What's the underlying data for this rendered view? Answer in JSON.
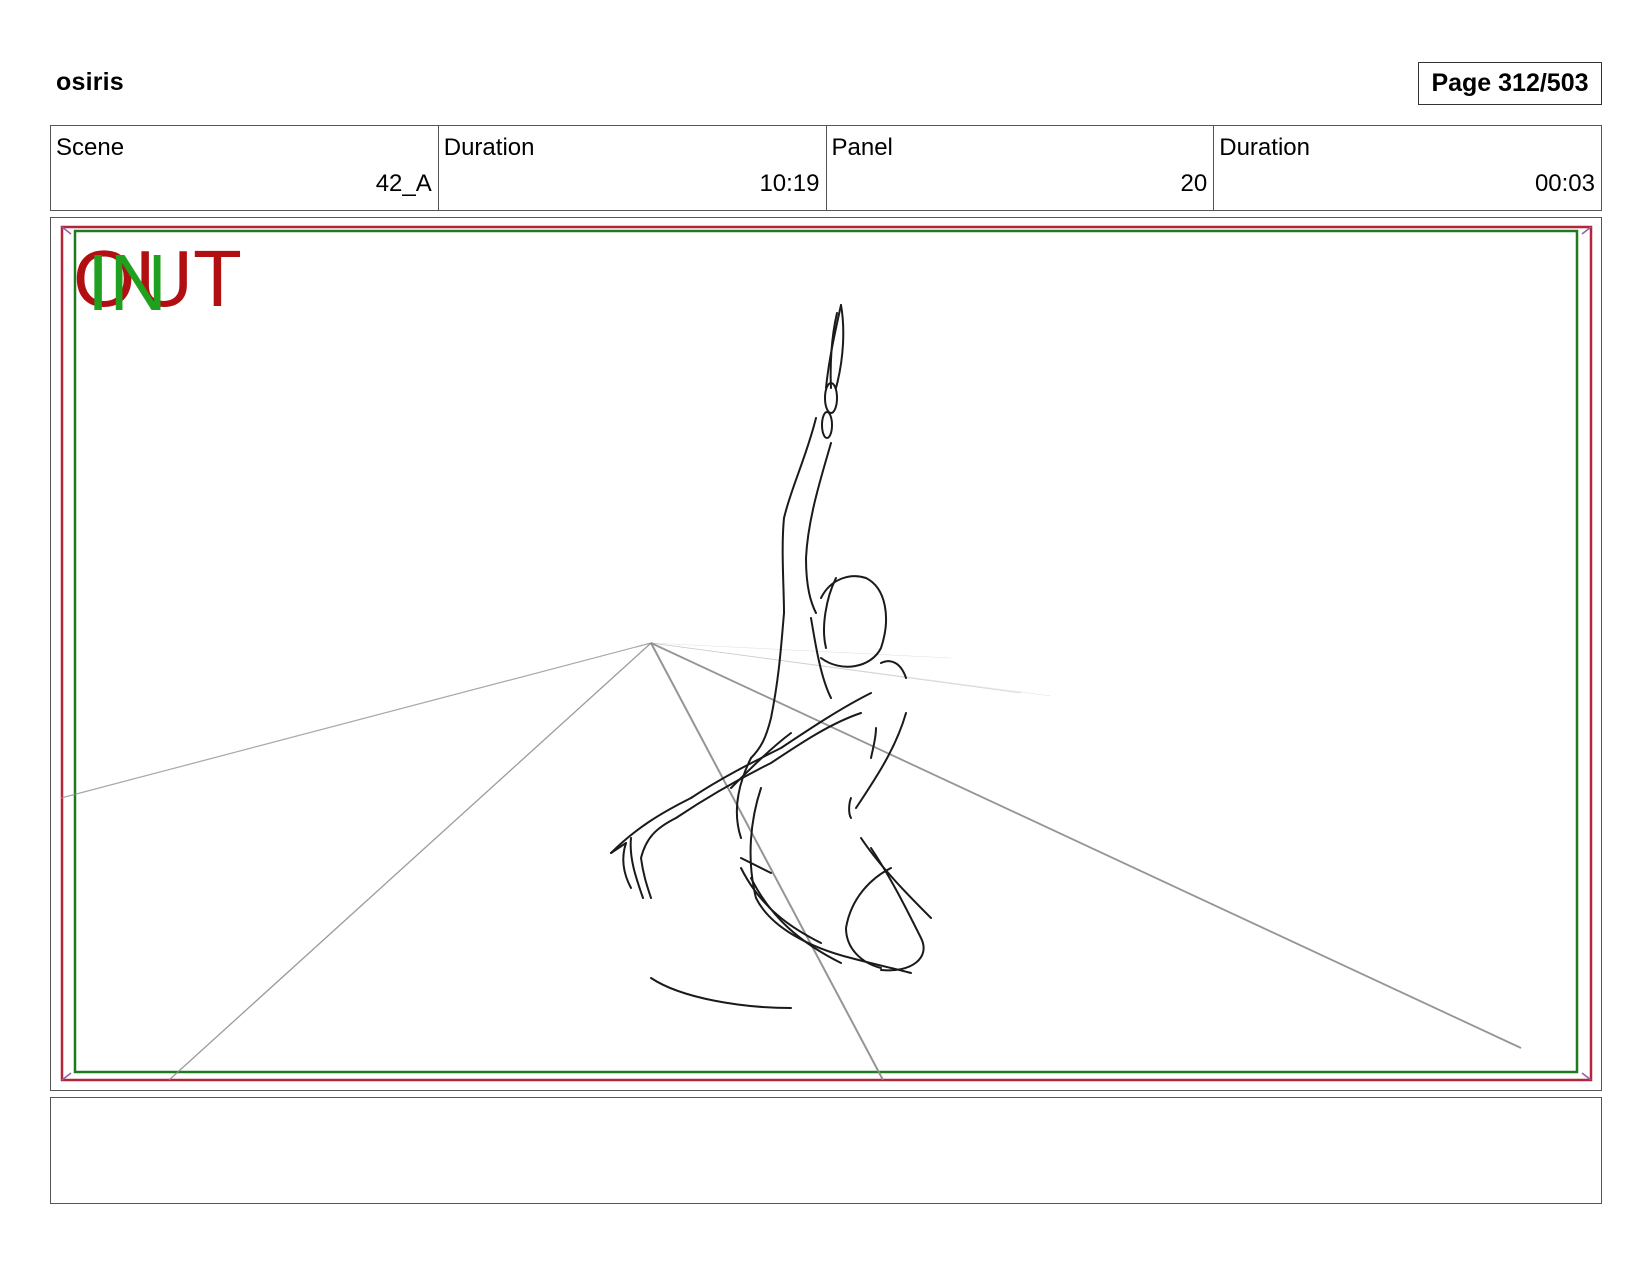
{
  "header": {
    "project_title": "osiris",
    "page_label": "Page 312/503"
  },
  "info_table": {
    "cells": [
      {
        "label": "Scene",
        "value": "42_A"
      },
      {
        "label": "Duration",
        "value": "10:19"
      },
      {
        "label": "Panel",
        "value": "20"
      },
      {
        "label": "Duration",
        "value": "00:03"
      }
    ]
  },
  "panel": {
    "out_marker": "OUT",
    "in_marker": "IN",
    "colors": {
      "out_marker": "#b10f12",
      "in_marker": "#1fa01f",
      "outer_safe_frame": "#b3263a",
      "inner_safe_frame": "#1e7a1e",
      "sketch_line": "#1a1a1a",
      "perspective_line": "#8a8a8a"
    }
  },
  "caption": {
    "text": ""
  }
}
